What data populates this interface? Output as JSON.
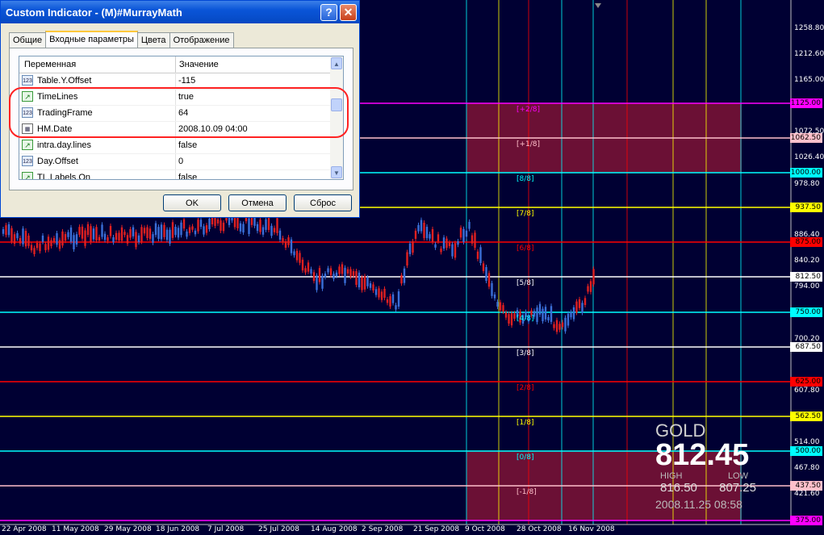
{
  "chart": {
    "price_axis": [
      "1258.80",
      "1212.60",
      "1165.00",
      "1072.50",
      "1026.40",
      "978.80",
      "886.40",
      "840.20",
      "794.00",
      "700.20",
      "607.80",
      "514.00",
      "467.80",
      "421.60"
    ],
    "date_axis": [
      "22 Apr 2008",
      "11 May 2008",
      "29 May 2008",
      "18 Jun 2008",
      "7 Jul 2008",
      "25 Jul 2008",
      "14 Aug 2008",
      "2 Sep 2008",
      "21 Sep 2008",
      "9 Oct 2008",
      "28 Oct 2008",
      "16 Nov 2008"
    ],
    "murray_levels": [
      {
        "label": "[+2/8]",
        "price": "1125.00",
        "color": "#ff00ff"
      },
      {
        "label": "[+1/8]",
        "price": "1062.50",
        "color": "#ffc0cb"
      },
      {
        "label": "[8/8]",
        "price": "1000.00",
        "color": "#00ffff"
      },
      {
        "label": "[7/8]",
        "price": "937.50",
        "color": "#ffff00"
      },
      {
        "label": "[6/8]",
        "price": "875.00",
        "color": "#ff0000"
      },
      {
        "label": "[5/8]",
        "price": "812.50",
        "color": "#ffffff"
      },
      {
        "label": "[4/8]",
        "price": "750.00",
        "color": "#00ffff"
      },
      {
        "label": "[3/8]",
        "price": "687.50",
        "color": "#ffffff"
      },
      {
        "label": "[2/8]",
        "price": "625.00",
        "color": "#ff0000"
      },
      {
        "label": "[1/8]",
        "price": "562.50",
        "color": "#ffff00"
      },
      {
        "label": "[0/8]",
        "price": "500.00",
        "color": "#00ffff"
      },
      {
        "label": "[-1/8]",
        "price": "437.50",
        "color": "#ffc0cb"
      },
      {
        "label": "",
        "price": "375.00",
        "color": "#ff00ff"
      }
    ]
  },
  "info": {
    "symbol": "GOLD",
    "price": "812.45",
    "high_label": "HIGH",
    "low_label": "LOW",
    "high": "816.50",
    "low": "807.25",
    "datetime": "2008.11.25 08:58"
  },
  "dialog": {
    "title": "Custom Indicator - (M)#MurrayMath",
    "help_glyph": "?",
    "close_glyph": "✕",
    "tabs": [
      "Общие",
      "Входные параметры",
      "Цвета",
      "Отображение"
    ],
    "col_variable": "Переменная",
    "col_value": "Значение",
    "rows": [
      {
        "icon": "123",
        "name": "Table.Y.Offset",
        "value": "-115"
      },
      {
        "icon": "bool",
        "name": "TimeLines",
        "value": "true"
      },
      {
        "icon": "123",
        "name": "TradingFrame",
        "value": "64"
      },
      {
        "icon": "date",
        "name": "HM.Date",
        "value": "2008.10.09 04:00"
      },
      {
        "icon": "bool",
        "name": "intra.day.lines",
        "value": "false"
      },
      {
        "icon": "123",
        "name": "Day.Offset",
        "value": "0"
      },
      {
        "icon": "bool",
        "name": "TL.Labels.On",
        "value": "false"
      }
    ],
    "ok": "OK",
    "cancel": "Отмена",
    "reset": "Сброс"
  }
}
